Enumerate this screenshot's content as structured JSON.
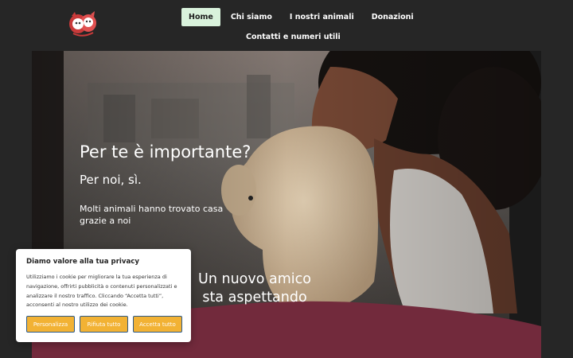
{
  "nav": {
    "items": [
      {
        "label": "Home",
        "active": true
      },
      {
        "label": "Chi siamo"
      },
      {
        "label": "I nostri animali"
      },
      {
        "label": "Donazioni"
      }
    ],
    "second_row": {
      "label": "Contatti e numeri utili"
    }
  },
  "hero": {
    "title": "Per te è importante?",
    "subtitle": "Per noi, sì.",
    "body": "Molti animali hanno trovato casa grazie a noi"
  },
  "band": {
    "line1": "Un nuovo amico",
    "line2": "sta aspettando"
  },
  "cookie": {
    "title": "Diamo valore alla tua privacy",
    "text": "Utilizziamo i cookie per migliorare la tua esperienza di navigazione, offrirti pubblicità o contenuti personalizzati e analizzare il nostro traffico. Cliccando “Accetta tutti”, acconsenti al nostro utilizzo dei cookie.",
    "customize_label": "Personalizza",
    "reject_label": "Rifiuta tutto",
    "accept_label": "Accetta tutto"
  },
  "colors": {
    "brand_maroon": "#722a3c",
    "nav_active_bg": "#d9f2dc",
    "cookie_button": "#f2b234",
    "page_bg": "#262626"
  }
}
